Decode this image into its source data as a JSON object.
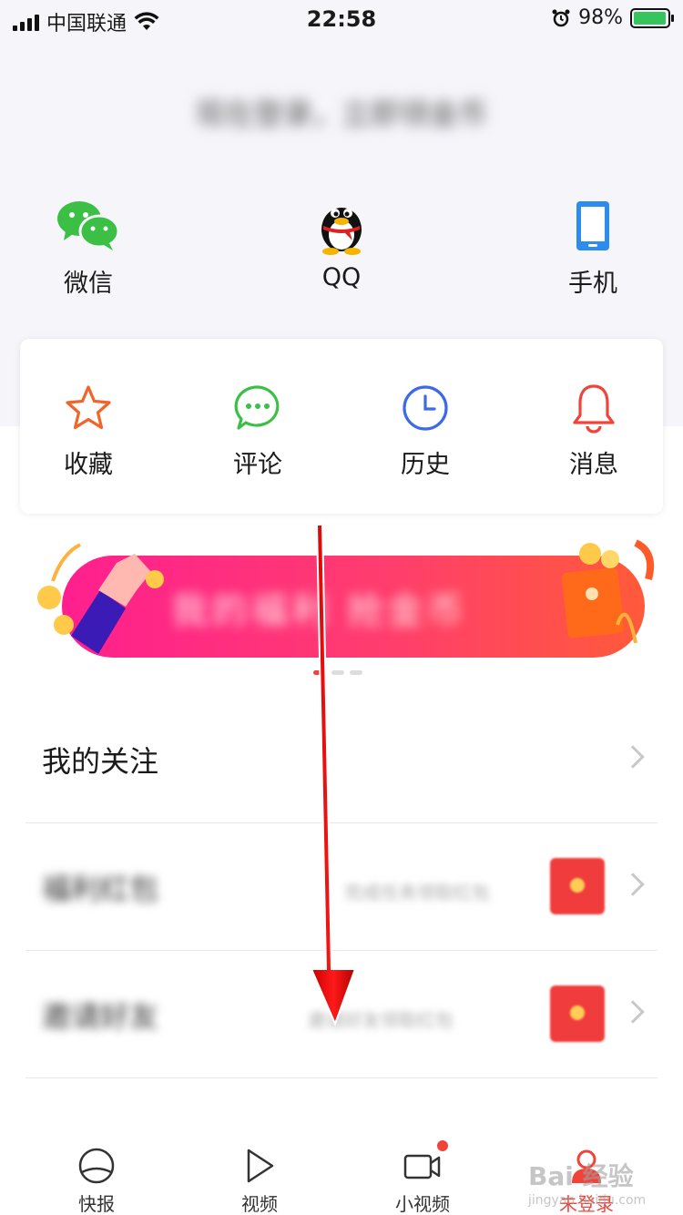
{
  "status_bar": {
    "carrier": "中国联通",
    "time": "22:58",
    "battery": "98%",
    "battery_level": 0.98
  },
  "login": {
    "hint": "现在登录，立即领金币",
    "methods": [
      {
        "label": "微信",
        "icon": "wechat-icon"
      },
      {
        "label": "QQ",
        "icon": "qq-penguin-icon"
      },
      {
        "label": "手机",
        "icon": "phone-icon"
      }
    ]
  },
  "quick_actions": [
    {
      "label": "收藏",
      "icon": "star-icon",
      "color": "#f0652a"
    },
    {
      "label": "评论",
      "icon": "comment-icon",
      "color": "#3bbf45"
    },
    {
      "label": "历史",
      "icon": "clock-icon",
      "color": "#3d6ae8"
    },
    {
      "label": "消息",
      "icon": "bell-icon",
      "color": "#f0443a"
    }
  ],
  "banner": {
    "text": "我的福利 抢金币",
    "carousel_total": 3,
    "carousel_active": 1
  },
  "list": [
    {
      "title": "我的关注",
      "subtitle": ""
    },
    {
      "title": "福利红包",
      "subtitle": "完成任务领取红包"
    },
    {
      "title": "邀请好友",
      "subtitle": "邀请好友领取红包"
    }
  ],
  "tabbar": [
    {
      "label": "快报",
      "icon": "kuaibao-icon",
      "active": false
    },
    {
      "label": "视频",
      "icon": "play-icon",
      "active": false
    },
    {
      "label": "小视频",
      "icon": "video-camera-icon",
      "active": false
    },
    {
      "label": "未登录",
      "icon": "user-icon",
      "active": true
    }
  ],
  "watermark": {
    "text": "Bai 经验",
    "sub": "jingyan.baidu.com"
  },
  "colors": {
    "accent": "#f0443a",
    "background_top": "#f5f5fa",
    "wechat": "#3bbf45",
    "phone": "#2d8cf0"
  }
}
